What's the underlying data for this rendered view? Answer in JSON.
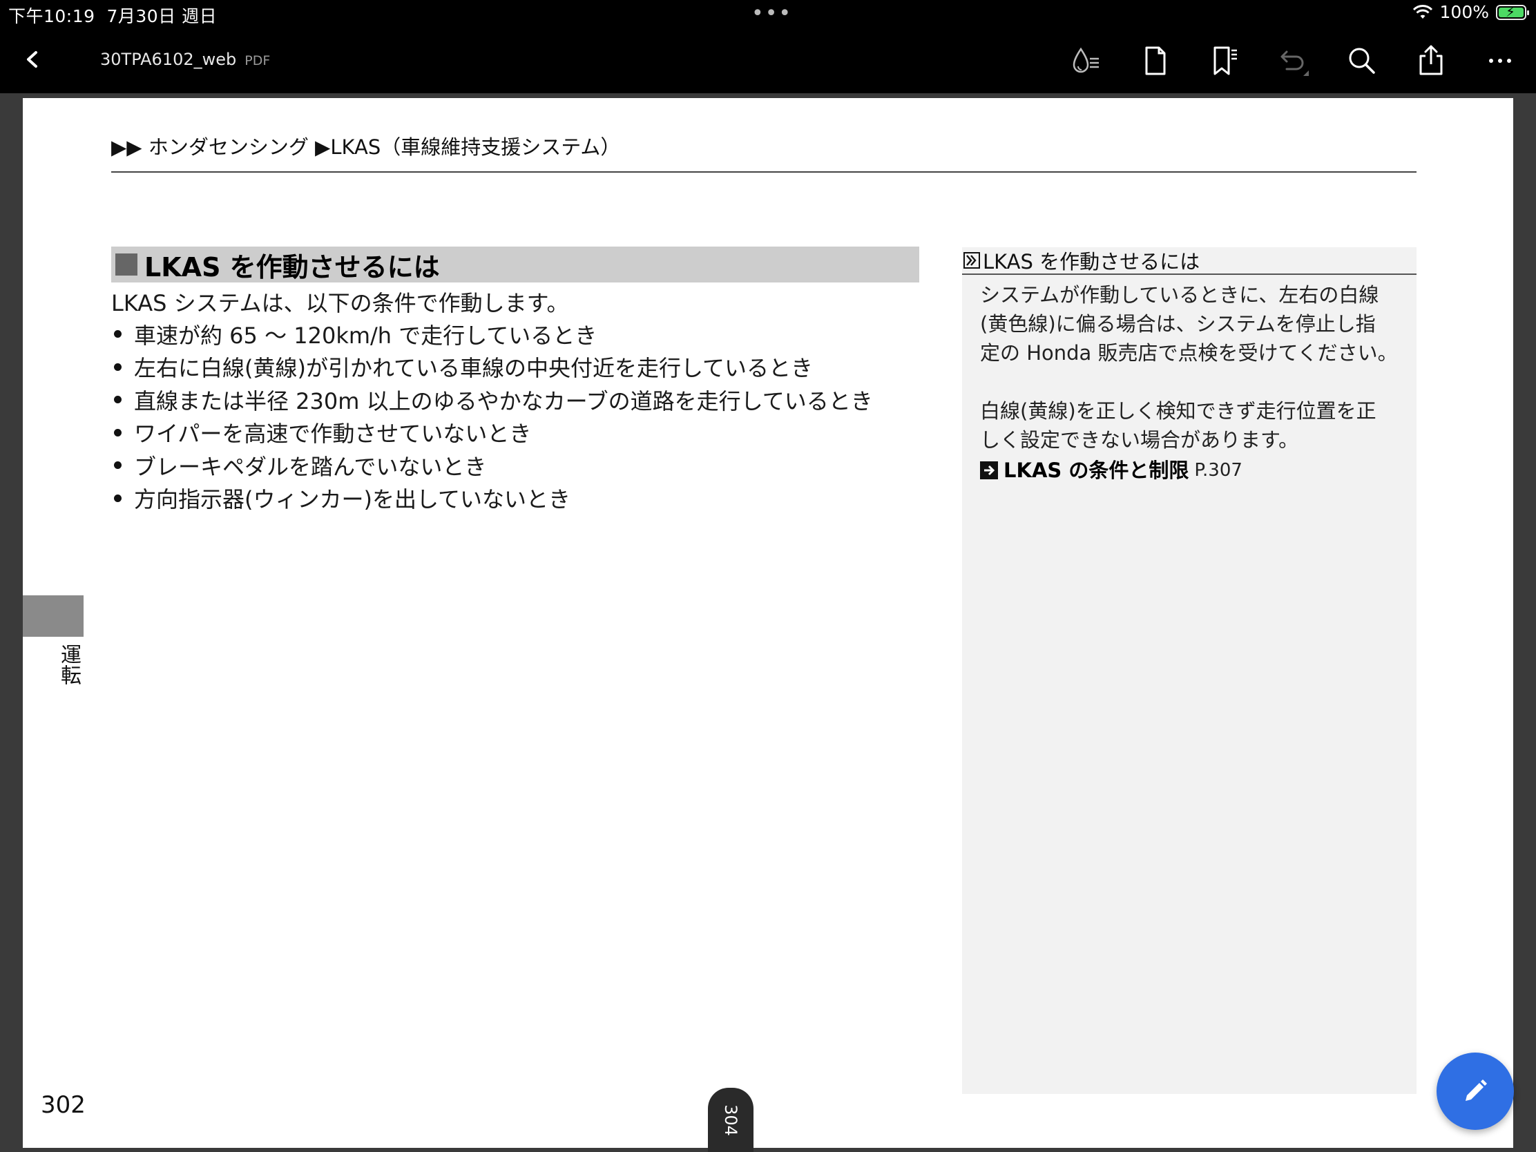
{
  "status_bar": {
    "time": "下午10:19",
    "date": "7月30日 週日",
    "battery_percent": "100%",
    "battery_level": 1.0
  },
  "toolbar": {
    "doc_title": "30TPA6102_web",
    "doc_type": "PDF",
    "icons": [
      "back-icon",
      "ink-icon",
      "page-icon",
      "bookmark-list-icon",
      "undo-icon",
      "search-icon",
      "share-icon",
      "more-icon"
    ]
  },
  "page": {
    "breadcrumb": "▶▶ ホンダセンシング ▶LKAS（車線維持支援システム）",
    "heading": "LKAS を作動させるには",
    "intro": "LKAS システムは、以下の条件で作動します。",
    "bullets": [
      "車速が約 65 ～ 120km/h で走行しているとき",
      "左右に白線(黄線)が引かれている車線の中央付近を走行しているとき",
      "直線または半径 230m 以上のゆるやかなカーブの道路を走行しているとき",
      "ワイパーを高速で作動させていないとき",
      "ブレーキペダルを踏んでいないとき",
      "方向指示器(ウィンカー)を出していないとき"
    ],
    "note": {
      "title": "LKAS を作動させるには",
      "paragraph1_lines": [
        "システムが作動しているときに、左右の白線",
        "(黄色線)に偏る場合は、システムを停止し指",
        "定の Honda 販売店で点検を受けてください。"
      ],
      "paragraph2_lines": [
        "白線(黄線)を正しく検知できず走行位置を正",
        "しく設定できない場合があります。"
      ],
      "link_text": "LKAS の条件と制限",
      "link_page": "P.307"
    },
    "side_tab": "運転",
    "page_number": "302"
  },
  "page_indicator": "304",
  "colors": {
    "fab": "#2f6fe4",
    "battery": "#4cd964"
  }
}
